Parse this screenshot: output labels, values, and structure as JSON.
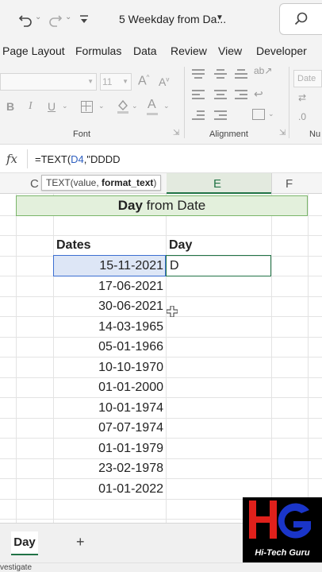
{
  "titlebar": {
    "doc_title": "5 Weekday from Da...",
    "icons": [
      "undo-icon",
      "redo-icon",
      "customize-toolbar-icon",
      "search-icon"
    ]
  },
  "ribbon": {
    "tabs": [
      "Page Layout",
      "Formulas",
      "Data",
      "Review",
      "View",
      "Developer"
    ],
    "font_size": "11",
    "groups": {
      "font": "Font",
      "alignment": "Alignment",
      "number": "Nu"
    },
    "number_format": "Date",
    "font_buttons": {
      "bold": "B",
      "italic": "I",
      "underline": "U"
    }
  },
  "formula_bar": {
    "fx_label": "fx",
    "formula_prefix": "=TEXT(",
    "formula_ref": "D4",
    "formula_suffix": ",\"DDDD"
  },
  "tooltip": {
    "prefix": "TEXT(value, ",
    "bold_arg": "format_text",
    "suffix": ")"
  },
  "columns": {
    "c": "C",
    "e": "E",
    "f": "F"
  },
  "sheet": {
    "banner_bold": "Day",
    "banner_rest": " from Date",
    "header_dates": "Dates",
    "header_day": "Day",
    "dates": [
      "15-11-2021",
      "17-06-2021",
      "30-06-2021",
      "14-03-1965",
      "05-01-1966",
      "10-10-1970",
      "01-01-2000",
      "10-01-1974",
      "07-07-1974",
      "01-01-1979",
      "23-02-1978",
      "01-01-2022"
    ],
    "editing_value": "D"
  },
  "sheet_tabs": {
    "active": "Day",
    "add": "+"
  },
  "status": "vestigate",
  "logo": {
    "text": "Hi-Tech Guru",
    "colors": {
      "red": "#e0201b",
      "blue": "#1a35c9"
    }
  },
  "colors": {
    "excel_green": "#217346",
    "selection_blue": "#3c6fd1",
    "banner_fill": "#e3f0dc"
  }
}
